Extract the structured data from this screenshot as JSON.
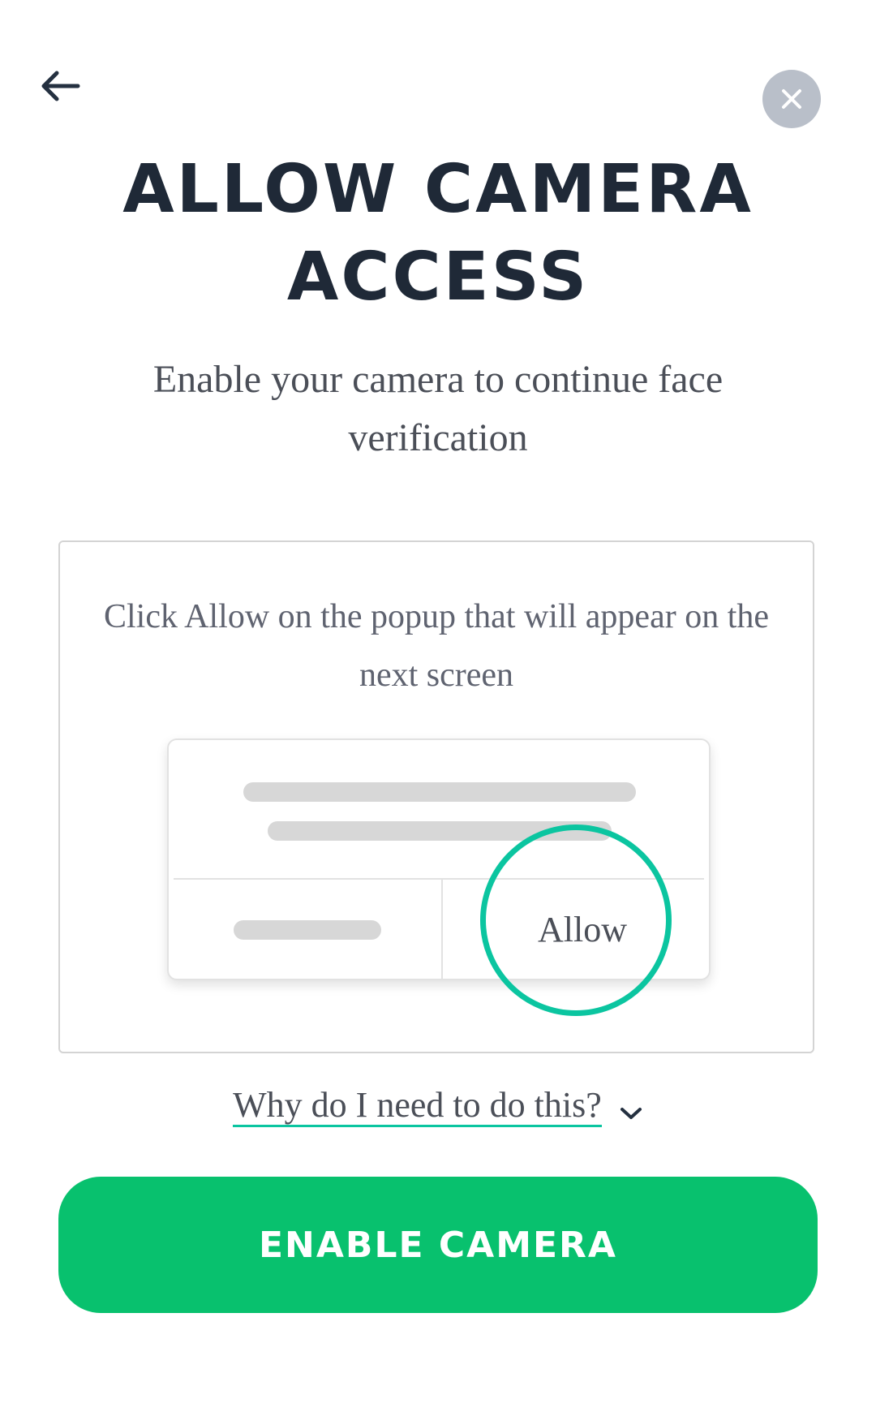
{
  "header": {
    "back_icon": "arrow-left-icon",
    "close_icon": "close-icon"
  },
  "title": "ALLOW CAMERA ACCESS",
  "subtitle": "Enable your camera to continue face verification",
  "instruction_card": {
    "text": "Click Allow on the popup that will appear on the next screen",
    "popup_mock": {
      "allow_label": "Allow"
    },
    "highlight_color": "#0bc5a0"
  },
  "help_link": {
    "label": "Why do I need to do this?",
    "icon": "chevron-down-icon"
  },
  "primary_button": {
    "label": "ENABLE CAMERA",
    "color": "#08c16e"
  }
}
